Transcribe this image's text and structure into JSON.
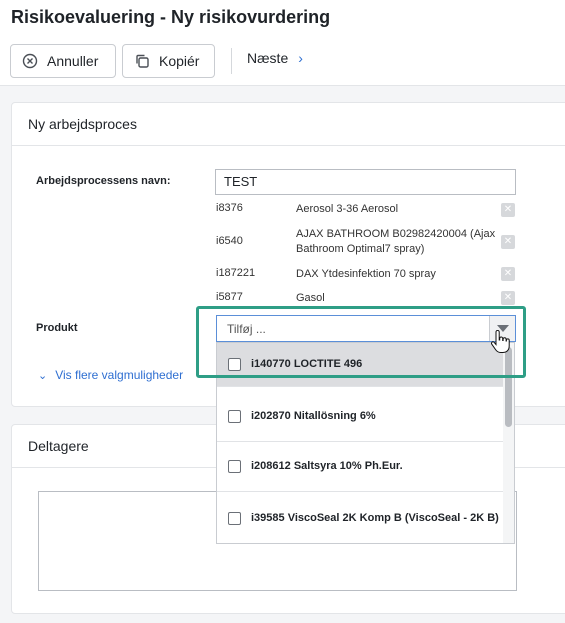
{
  "header": {
    "title": "Risikoevaluering - Ny risikovurdering",
    "cancel_label": "Annuller",
    "copy_label": "Kopiér",
    "next_label": "Næste"
  },
  "section1": {
    "title": "Ny arbejdsproces",
    "name_label": "Arbejdsprocessens navn:",
    "name_value": "TEST",
    "products": [
      {
        "id": "i8376",
        "name": "Aerosol 3-36 Aerosol"
      },
      {
        "id": "i6540",
        "name": "AJAX BATHROOM B02982420004 (Ajax Bathroom Optimal7 spray)"
      },
      {
        "id": "i187221",
        "name": "DAX Ytdesinfektion 70 spray"
      },
      {
        "id": "i5877",
        "name": "Gasol"
      }
    ],
    "product_label": "Produkt",
    "select_placeholder": "Tilføj ...",
    "more_options_label": "Vis flere valgmuligheder"
  },
  "dropdown": {
    "options": [
      {
        "label": "i140770 LOCTITE 496",
        "checked": false
      },
      {
        "label": "i202870 Nitallösning 6%",
        "checked": false
      },
      {
        "label": "i208612 Saltsyra 10% Ph.Eur.",
        "checked": false
      },
      {
        "label": "i39585 ViscoSeal 2K Komp B (ViscoSeal - 2K B)",
        "checked": false
      }
    ]
  },
  "section2": {
    "title": "Deltagere"
  },
  "colors": {
    "accent": "#2f6fd1",
    "highlight": "#2e9e86"
  }
}
